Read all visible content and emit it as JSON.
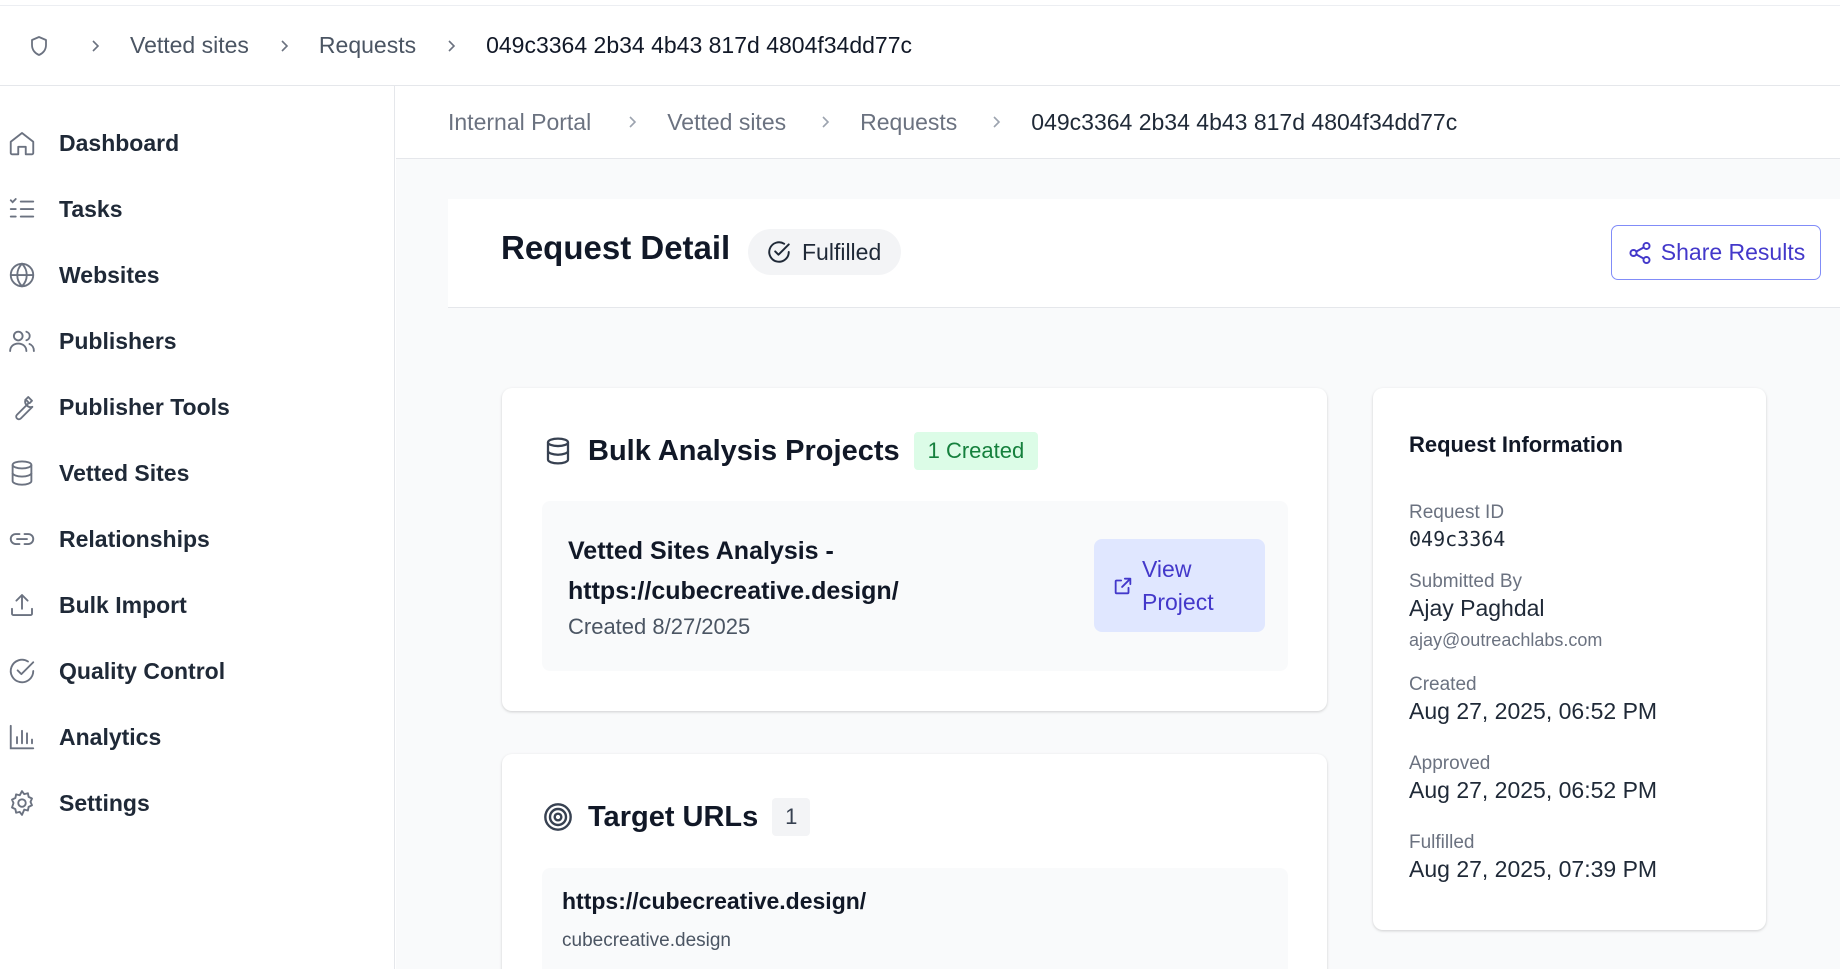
{
  "topbar": {
    "home_icon": "shield-icon",
    "crumbs": [
      "Vetted sites",
      "Requests"
    ],
    "current": "049c3364 2b34 4b43 817d 4804f34dd77c"
  },
  "sidebar": {
    "items": [
      {
        "label": "Dashboard",
        "icon": "home-icon"
      },
      {
        "label": "Tasks",
        "icon": "list-checks-icon"
      },
      {
        "label": "Websites",
        "icon": "globe-icon"
      },
      {
        "label": "Publishers",
        "icon": "users-icon"
      },
      {
        "label": "Publisher Tools",
        "icon": "wrench-icon"
      },
      {
        "label": "Vetted Sites",
        "icon": "database-icon"
      },
      {
        "label": "Relationships",
        "icon": "link-icon"
      },
      {
        "label": "Bulk Import",
        "icon": "upload-icon"
      },
      {
        "label": "Quality Control",
        "icon": "check-circle-icon"
      },
      {
        "label": "Analytics",
        "icon": "bar-chart-icon"
      },
      {
        "label": "Settings",
        "icon": "gear-icon"
      }
    ]
  },
  "subcrumb": {
    "crumbs": [
      "Internal Portal",
      "Vetted sites",
      "Requests"
    ],
    "current": "049c3364 2b34 4b43 817d 4804f34dd77c"
  },
  "header": {
    "title": "Request Detail",
    "status": "Fulfilled",
    "share_label": "Share Results"
  },
  "bulk": {
    "title": "Bulk Analysis Projects",
    "badge": "1 Created",
    "project": {
      "name_line1": "Vetted Sites Analysis -",
      "name_line2": "https://cubecreative.design/",
      "created": "Created 8/27/2025",
      "view_line1": "View",
      "view_line2": "Project"
    }
  },
  "targets": {
    "title": "Target URLs",
    "count": "1",
    "items": [
      {
        "url": "https://cubecreative.design/",
        "domain": "cubecreative.design"
      }
    ]
  },
  "info": {
    "title": "Request Information",
    "request_id_label": "Request ID",
    "request_id": "049c3364",
    "submitted_label": "Submitted By",
    "submitted_name": "Ajay Paghdal",
    "submitted_email": "ajay@outreachlabs.com",
    "created_label": "Created",
    "created": "Aug 27, 2025, 06:52 PM",
    "approved_label": "Approved",
    "approved": "Aug 27, 2025, 06:52 PM",
    "fulfilled_label": "Fulfilled",
    "fulfilled": "Aug 27, 2025, 07:39 PM"
  },
  "colors": {
    "accent": "#4338ca",
    "accent_bg": "#e0e7ff",
    "success_bg": "#dcfce7",
    "success_text": "#15803d"
  }
}
